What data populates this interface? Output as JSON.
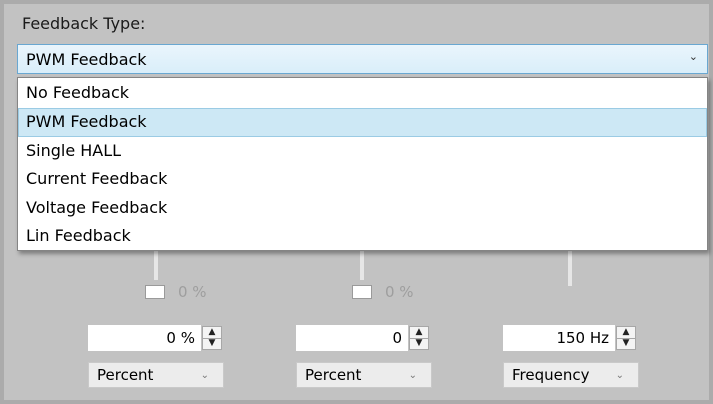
{
  "feedback_type": {
    "label": "Feedback Type:",
    "selected": "PWM Feedback",
    "options": [
      "No Feedback",
      "PWM Feedback",
      "Single HALL",
      "Current Feedback",
      "Voltage Feedback",
      "Lin Feedback"
    ]
  },
  "channels": [
    {
      "indicator_value": "0 %",
      "input_value": "0 %",
      "mode": "Percent"
    },
    {
      "indicator_value": "0 %",
      "input_value": "0",
      "mode": "Percent"
    },
    {
      "input_value": "150 Hz",
      "mode": "Frequency"
    }
  ],
  "icons": {
    "combo_arrow": "chevron-down-icon",
    "spin_up": "triangle-up-icon",
    "spin_down": "triangle-down-icon"
  }
}
